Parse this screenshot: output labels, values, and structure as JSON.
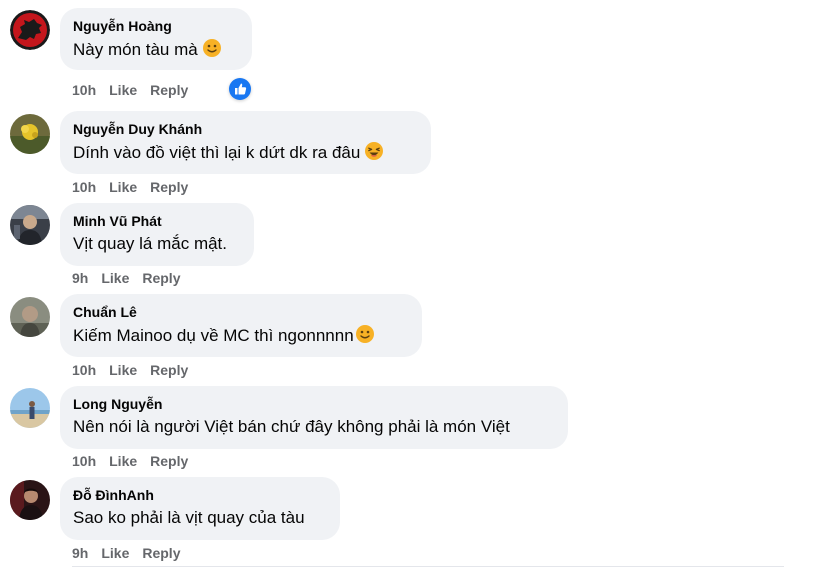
{
  "labels": {
    "like": "Like",
    "reply": "Reply"
  },
  "comments": [
    {
      "author": "Nguyễn Hoàng",
      "text": "Này món tàu mà",
      "emoji": "slight-smile",
      "time": "10h",
      "reaction": "like"
    },
    {
      "author": "Nguyễn Duy Khánh",
      "text": "Dính vào đồ việt thì lại k dứt dk ra đâu",
      "emoji": "laughing",
      "time": "10h"
    },
    {
      "author": "Minh Vũ Phát",
      "text": "Vịt quay lá mắc mật.",
      "time": "9h"
    },
    {
      "author": "Chuẩn Lê",
      "text": "Kiếm Mainoo dụ về MC thì ngonnnnn",
      "emoji": "slight-smile",
      "time": "10h"
    },
    {
      "author": "Long Nguyễn",
      "text": "Nên nói là người Việt bán chứ đây không phải là món Việt",
      "time": "10h"
    },
    {
      "author": "Đỗ ĐìnhAnh",
      "text": "Sao ko phải là vịt quay của tàu",
      "time": "9h"
    }
  ],
  "colors": {
    "bubble": "#f0f2f5",
    "meta_text": "#65676b",
    "like_blue": "#1877f2",
    "emoji_yellow": "#f7b125"
  }
}
